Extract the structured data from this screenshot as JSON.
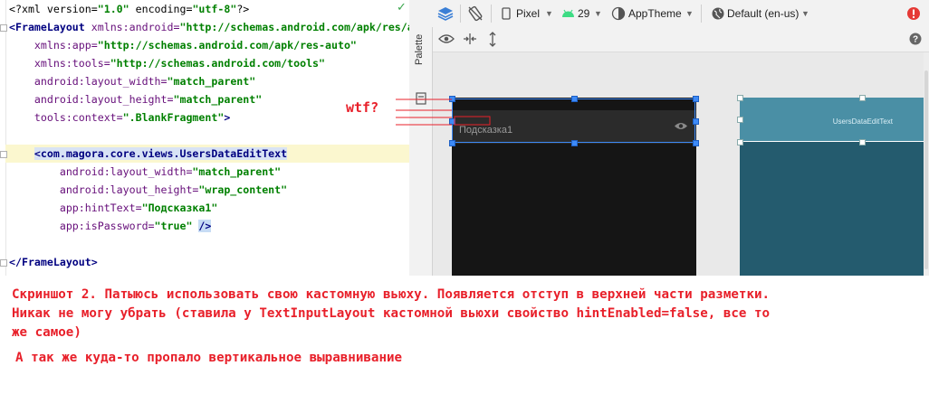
{
  "editor": {
    "lines": [
      {
        "parts": [
          [
            "pi",
            "<?xml version="
          ],
          [
            "str",
            "\"1.0\""
          ],
          [
            "pi",
            " encoding="
          ],
          [
            "str",
            "\"utf-8\""
          ],
          [
            "pi",
            "?>"
          ]
        ]
      },
      {
        "parts": [
          [
            "tag",
            "<FrameLayout "
          ],
          [
            "attr",
            "xmlns:android="
          ],
          [
            "str",
            "\"http://schemas.android.com/apk/res/a"
          ]
        ]
      },
      {
        "parts": [
          [
            "attr",
            "    xmlns:app="
          ],
          [
            "str",
            "\"http://schemas.android.com/apk/res-auto\""
          ]
        ]
      },
      {
        "parts": [
          [
            "attr",
            "    xmlns:tools="
          ],
          [
            "str",
            "\"http://schemas.android.com/tools\""
          ]
        ]
      },
      {
        "parts": [
          [
            "attr",
            "    android:layout_width="
          ],
          [
            "str",
            "\"match_parent\""
          ]
        ]
      },
      {
        "parts": [
          [
            "attr",
            "    android:layout_height="
          ],
          [
            "str",
            "\"match_parent\""
          ]
        ]
      },
      {
        "parts": [
          [
            "attr",
            "    tools:context="
          ],
          [
            "str",
            "\".BlankFragment\""
          ],
          [
            "tag",
            ">"
          ]
        ]
      },
      {
        "parts": []
      },
      {
        "hl": true,
        "parts": [
          [
            "pi",
            "    "
          ],
          [
            "taghl",
            "<com.magora.core.views.UsersDataEditText"
          ]
        ]
      },
      {
        "parts": [
          [
            "attr",
            "        android:layout_width="
          ],
          [
            "str",
            "\"match_parent\""
          ]
        ]
      },
      {
        "parts": [
          [
            "attr",
            "        android:layout_height="
          ],
          [
            "str",
            "\"wrap_content\""
          ]
        ]
      },
      {
        "parts": [
          [
            "attr",
            "        app:hintText="
          ],
          [
            "str",
            "\"Подсказка1\""
          ]
        ]
      },
      {
        "parts": [
          [
            "attr",
            "        app:isPassword="
          ],
          [
            "str",
            "\"true\""
          ],
          [
            "pi",
            " "
          ],
          [
            "caret",
            "/>"
          ]
        ]
      },
      {
        "parts": []
      },
      {
        "parts": [
          [
            "tag",
            "</FrameLayout>"
          ]
        ]
      }
    ]
  },
  "toolbar": {
    "device": "Pixel",
    "api_level": "29",
    "theme": "AppTheme",
    "locale": "Default (en-us)",
    "palette_label": "Palette"
  },
  "design": {
    "hint_text": "Подсказка1",
    "blueprint_label": "UsersDataEditText"
  },
  "annotation": {
    "wtf": "wtf?",
    "caption_line1": "Скриншот 2. Патыюсь использовать свою кастомную вьюху. Появляется отступ в верхней части разметки.",
    "caption_line2": "Никак не могу убрать (ставила у TextInputLayout кастомной вьюхи свойство hintEnabled=false, все то",
    "caption_line3": "же самое)",
    "caption_line4": "А так же куда-то пропало вертикальное выравнивание"
  },
  "colors": {
    "annotation_red": "#e8202a",
    "selection_blue": "#3d8af7",
    "blueprint_bg": "#245b6e",
    "design_bg": "#151515"
  }
}
